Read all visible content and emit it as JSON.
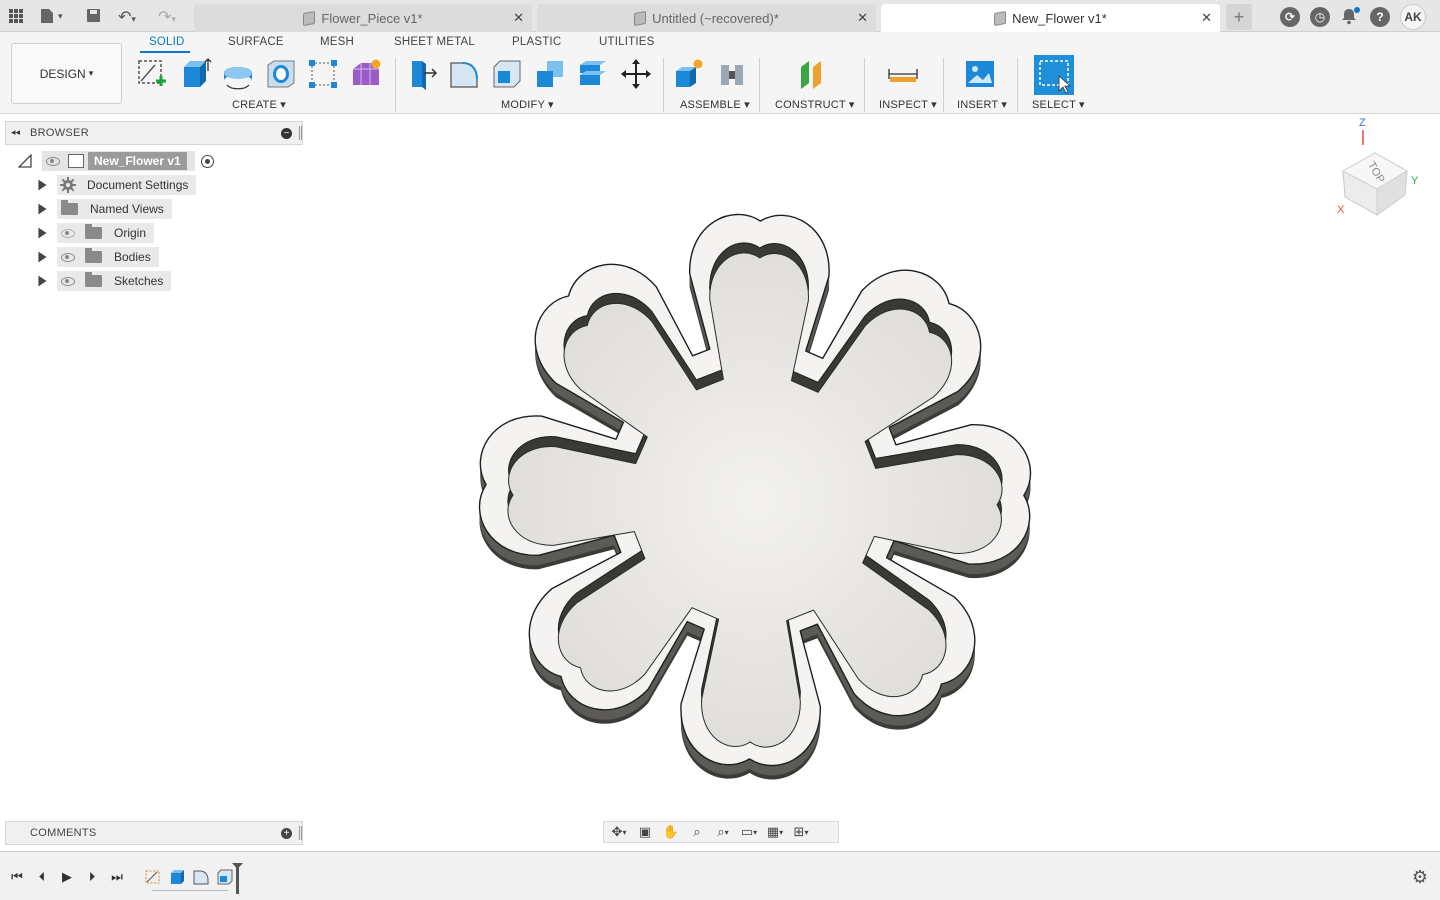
{
  "tabs": [
    {
      "title": "Flower_Piece v1*",
      "active": false
    },
    {
      "title": "Untitled (~recovered)*",
      "active": false
    },
    {
      "title": "New_Flower v1*",
      "active": true
    }
  ],
  "user": {
    "initials": "AK"
  },
  "toolbar": {
    "design_label": "DESIGN",
    "workspace_tabs": [
      "SOLID",
      "SURFACE",
      "MESH",
      "SHEET METAL",
      "PLASTIC",
      "UTILITIES"
    ],
    "groups": {
      "create": "CREATE",
      "modify": "MODIFY",
      "assemble": "ASSEMBLE",
      "construct": "CONSTRUCT",
      "inspect": "INSPECT",
      "insert": "INSERT",
      "select": "SELECT"
    }
  },
  "browser": {
    "title": "BROWSER",
    "root": "New_Flower v1",
    "items": [
      {
        "label": "Document Settings",
        "icon": "gear-icon"
      },
      {
        "label": "Named Views",
        "icon": "folder-icon"
      },
      {
        "label": "Origin",
        "icon": "folder-icon",
        "hidden": true
      },
      {
        "label": "Bodies",
        "icon": "folder-icon"
      },
      {
        "label": "Sketches",
        "icon": "folder-icon"
      }
    ]
  },
  "comments": {
    "title": "COMMENTS"
  },
  "viewcube": {
    "face": "TOP",
    "x_axis": "X",
    "y_axis": "Y",
    "z_axis": "Z"
  },
  "colors": {
    "accent": "#0a7acc",
    "select_tool": "#1e8fd8",
    "body_top": "#f4f3f1",
    "body_side": "#555450"
  }
}
